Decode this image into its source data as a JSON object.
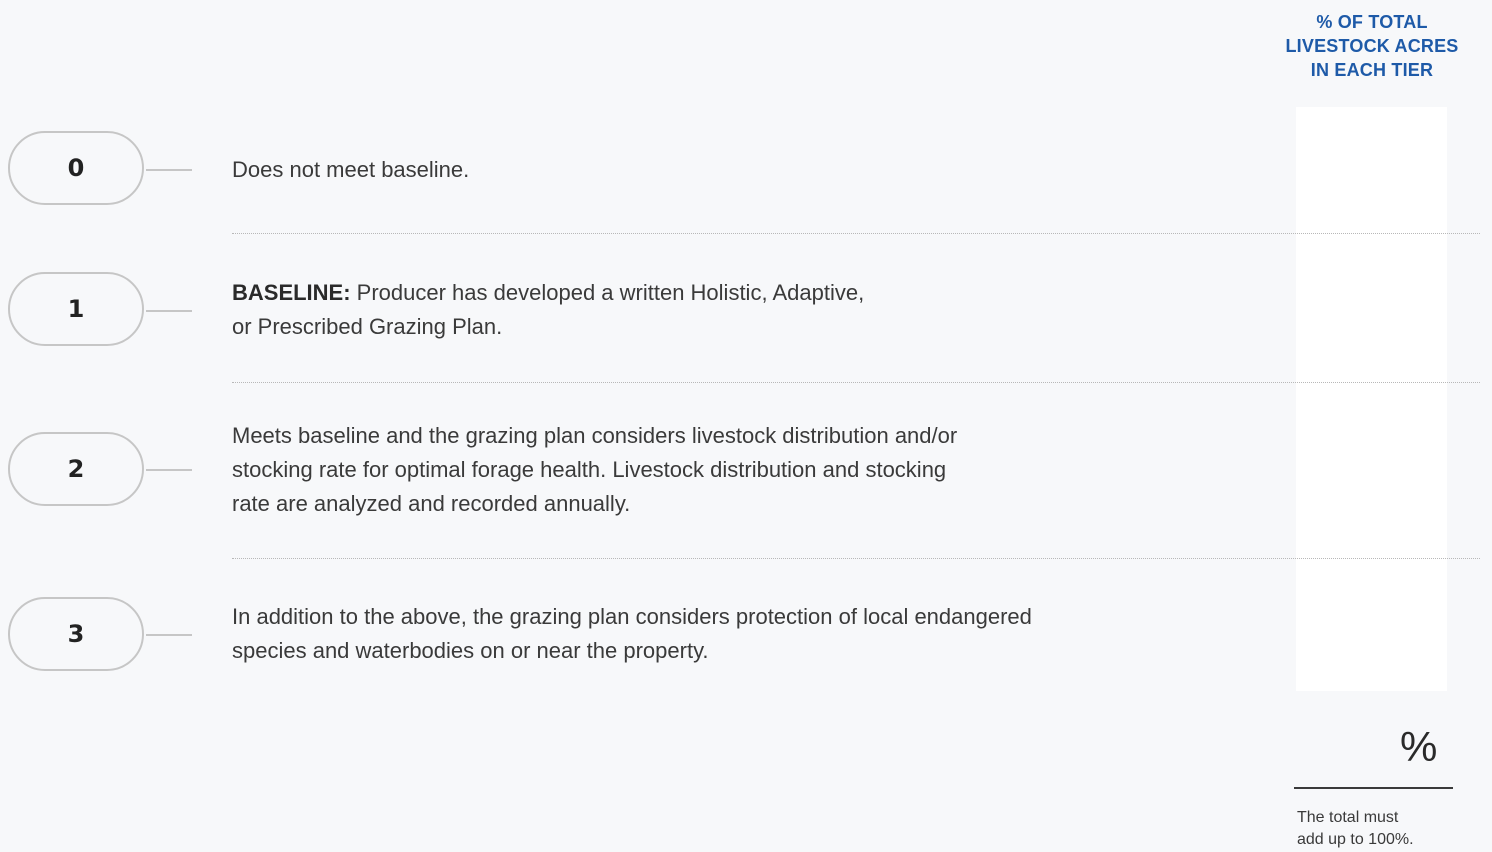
{
  "column_header": {
    "line1": "% OF TOTAL",
    "line2": "LIVESTOCK ACRES",
    "line3": "IN EACH TIER"
  },
  "tiers": [
    {
      "number": "0",
      "description": "Does not meet baseline.",
      "value": ""
    },
    {
      "number": "1",
      "lead": "BASELINE:",
      "line1": " Producer has developed a written Holistic, Adaptive,",
      "line2": "or Prescribed Grazing Plan.",
      "value": ""
    },
    {
      "number": "2",
      "line1": "Meets baseline and the grazing plan considers livestock distribution and/or",
      "line2": "stocking rate for optimal forage health. Livestock distribution and stocking",
      "line3": "rate are analyzed and recorded annually.",
      "value": ""
    },
    {
      "number": "3",
      "line1": "In addition to the above, the grazing plan considers protection of local endangered",
      "line2": "species and waterbodies on or near the property.",
      "value": ""
    }
  ],
  "total": {
    "symbol": "%",
    "note_line1": "The total must",
    "note_line2": "add up to 100%."
  },
  "colors": {
    "header_blue": "#1e5aa8",
    "pill_border": "#c6c6c6",
    "background": "#f7f8fa"
  }
}
